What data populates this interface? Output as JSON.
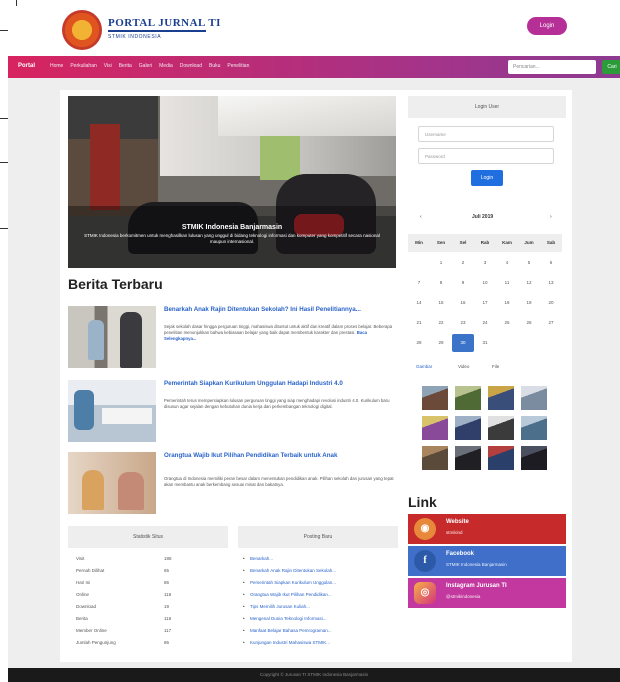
{
  "header": {
    "logo_title": "PORTAL JURNAL TI",
    "logo_subtitle": "STMIK INDONESIA",
    "login_label": "Login"
  },
  "nav": {
    "brand": "Portal",
    "items": [
      {
        "label": "Home"
      },
      {
        "label": "Perkuliahan"
      },
      {
        "label": "Visi"
      },
      {
        "label": "Berita"
      },
      {
        "label": "Galeri"
      },
      {
        "label": "Media"
      },
      {
        "label": "Download"
      },
      {
        "label": "Buku"
      },
      {
        "label": "Penelitian"
      }
    ],
    "search_placeholder": "Pencarian...",
    "search_button": "Cari"
  },
  "hero": {
    "title": "STMIK Indonesia Banjarmasin",
    "description": "STMIK Indonesia berkomitmen untuk menghasilkan lulusan yang unggul di bidang teknologi informasi dan komputer yang kompetitif secara nasional maupun internasional."
  },
  "news": {
    "section_title": "Berita Terbaru",
    "items": [
      {
        "headline": "Benarkah Anak Rajin Ditentukan Sekolah? Ini Hasil Penelitiannya...",
        "excerpt": "Sejak sekolah dasar hingga perguruan tinggi, mahasiswa dituntut untuk aktif dan kreatif dalam proses belajar. Beberapa penelitian menunjukkan bahwa kebiasaan belajar yang baik dapat membentuk karakter dan prestasi.",
        "more": "Baca Selengkapnya..."
      },
      {
        "headline": "Pemerintah Siapkan Kurikulum Unggulan Hadapi Industri 4.0",
        "excerpt": "Pemerintah terus mempersiapkan lulusan perguruan tinggi yang siap menghadapi revolusi industri 4.0. Kurikulum baru disusun agar sejalan dengan kebutuhan dunia kerja dan perkembangan teknologi digital."
      },
      {
        "headline": "Orangtua Wajib Ikut Pilihan Pendidikan Terbaik untuk Anak",
        "excerpt": "Orangtua di Indonesia memiliki peran besar dalam menentukan pendidikan anak. Pilihan sekolah dan jurusan yang tepat akan membantu anak berkembang sesuai minat dan bakatnya."
      }
    ]
  },
  "stats": {
    "title": "Statistik Situs",
    "rows": [
      {
        "label": "Visit",
        "value": "188"
      },
      {
        "label": "Pernah Dilihat",
        "value": "65"
      },
      {
        "label": "Hari Ini",
        "value": "86"
      },
      {
        "label": "Online",
        "value": "118"
      },
      {
        "label": "Download",
        "value": "19"
      },
      {
        "label": "Berita",
        "value": "118"
      },
      {
        "label": "Member Online",
        "value": "117"
      },
      {
        "label": "Jumlah Pengunjung",
        "value": "86"
      }
    ]
  },
  "recent": {
    "title": "Posting Baru",
    "items": [
      {
        "label": "Benarkah..."
      },
      {
        "label": "Benarkah Anak Rajin Ditentukan Sekolah..."
      },
      {
        "label": "Pemerintah Siapkan Kurikulum Unggulan..."
      },
      {
        "label": "Orangtua Wajib Ikut Pilihan Pendidikan..."
      },
      {
        "label": "Tips Memilih Jurusan Kuliah..."
      },
      {
        "label": "Mengenal Dunia Teknologi Informasi..."
      },
      {
        "label": "Manfaat Belajar Bahasa Pemrograman..."
      },
      {
        "label": "Kunjungan Industri Mahasiswa STMIK..."
      }
    ]
  },
  "login_panel": {
    "title": "Login User",
    "username_placeholder": "Username",
    "password_placeholder": "Password",
    "submit_label": "Login"
  },
  "calendar": {
    "month": "Juli 2019",
    "prev": "‹",
    "next": "›",
    "weekdays": [
      "Min",
      "Sen",
      "Sel",
      "Rab",
      "Kam",
      "Jum",
      "Sab"
    ],
    "rows": [
      [
        "",
        "1",
        "2",
        "3",
        "4",
        "5",
        "6"
      ],
      [
        "7",
        "8",
        "9",
        "10",
        "11",
        "12",
        "13"
      ],
      [
        "14",
        "15",
        "16",
        "17",
        "18",
        "19",
        "20"
      ],
      [
        "21",
        "22",
        "23",
        "24",
        "25",
        "26",
        "27"
      ],
      [
        "28",
        "29",
        "30",
        "31",
        "",
        "",
        ""
      ]
    ],
    "today": "30"
  },
  "gallery_tabs": [
    "Gambar",
    "Video",
    "File"
  ],
  "links": {
    "title": "Link",
    "items": [
      {
        "title": "Website",
        "subtitle": "stmikind",
        "color": "#c62a2a",
        "icon": "website-icon"
      },
      {
        "title": "Facebook",
        "subtitle": "STMIK Indonesia Banjarmasin",
        "color": "#3f6fc9",
        "icon": "facebook-icon"
      },
      {
        "title": "Instagram Jurusan TI",
        "subtitle": "@stmikindonesia",
        "color": "#c2389e",
        "icon": "instagram-icon"
      }
    ]
  },
  "footer": {
    "text": "Copyright © Jurusan TI STMIK Indonesia Banjarmasin"
  },
  "colors": {
    "nav_start": "#d7245f",
    "nav_end": "#8c3b91",
    "link_blue": "#2a63c8",
    "search_green": "#2c9c3b"
  }
}
